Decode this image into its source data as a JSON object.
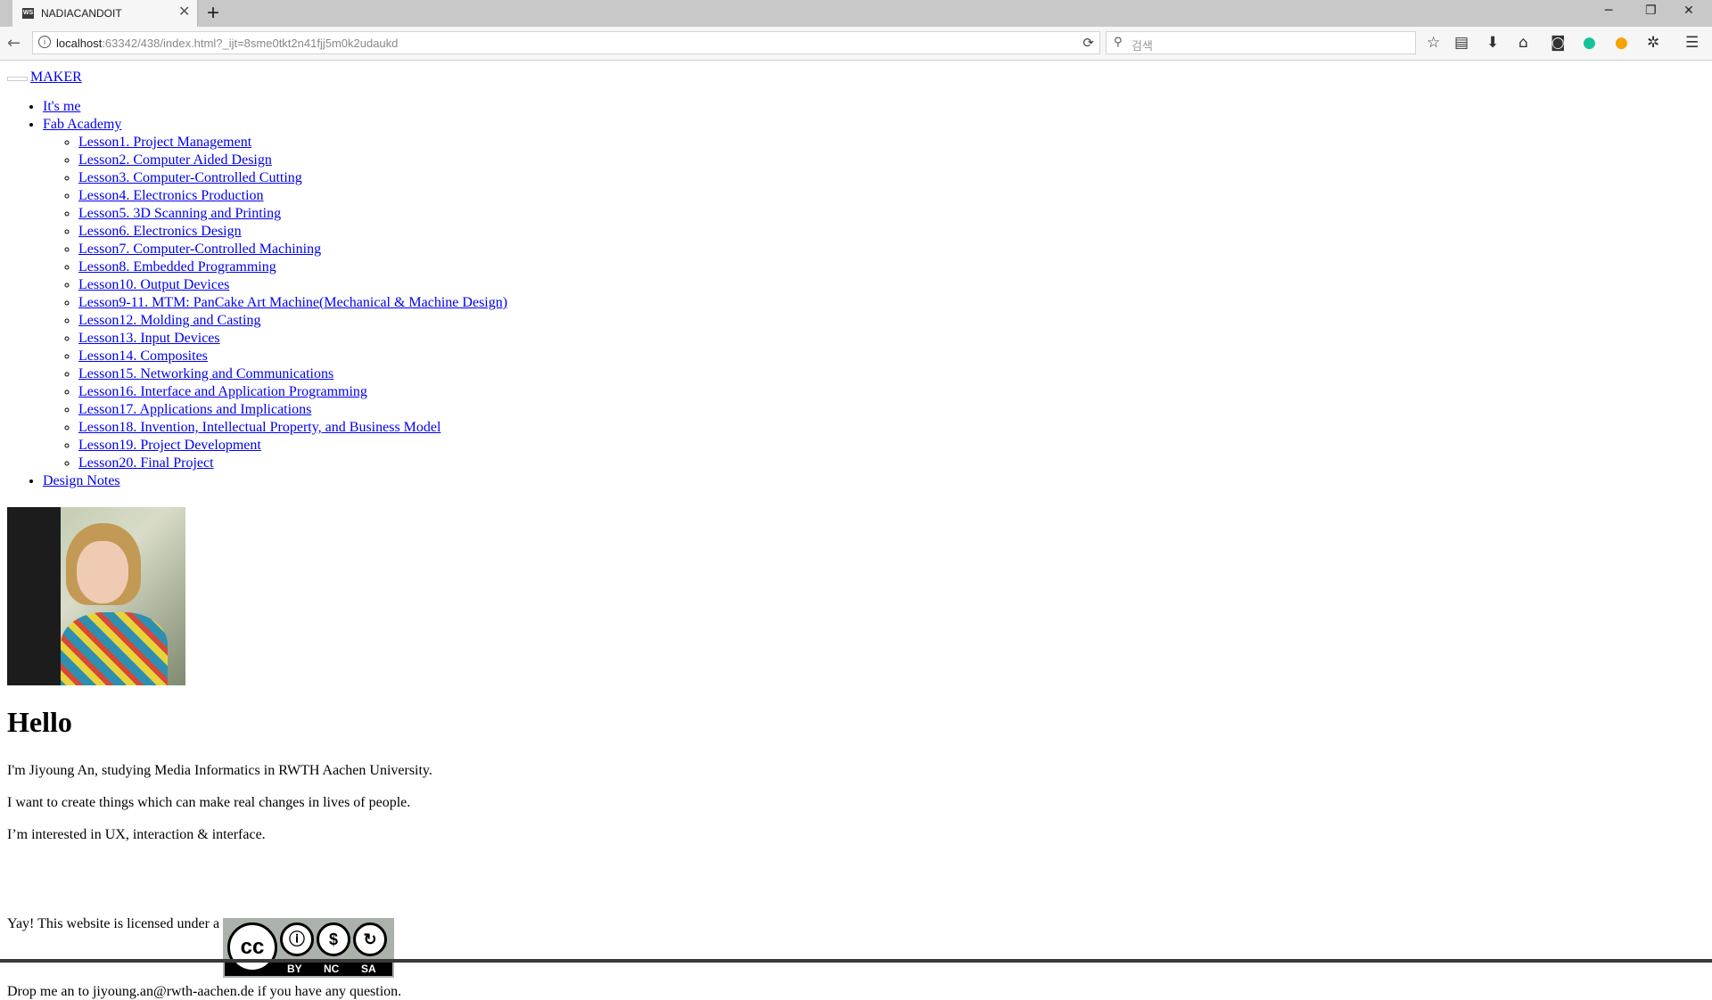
{
  "browser": {
    "tab_title": "NADIACANDOIT",
    "tab_favicon": "WS",
    "url_host": "localhost",
    "url_rest": ":63342/438/index.html?_ijt=8sme0tkt2n41fjj5m0k2udaukd",
    "search_placeholder": "검색",
    "icons": {
      "back": "back-arrow-icon",
      "info": "info-icon",
      "reload": "reload-icon",
      "search": "search-icon",
      "bookmark": "bookmark-star-icon",
      "reader": "reading-list-icon",
      "download": "download-icon",
      "home": "home-icon",
      "pocket": "pocket-icon",
      "grammarly": "grammarly-icon",
      "extension": "extension-icon",
      "puzzle": "addon-icon",
      "menu": "hamburger-menu-icon"
    }
  },
  "page": {
    "brand": "MAKER",
    "nav": {
      "its_me": "It's me",
      "fab_academy": "Fab Academy",
      "lessons": [
        "Lesson1. Project Management",
        "Lesson2. Computer Aided Design",
        "Lesson3. Computer-Controlled Cutting",
        "Lesson4. Electronics Production",
        "Lesson5. 3D Scanning and Printing",
        "Lesson6. Electronics Design",
        "Lesson7. Computer-Controlled Machining",
        "Lesson8. Embedded Programming",
        "Lesson10. Output Devices",
        "Lesson9-11. MTM: PanCake Art Machine(Mechanical & Machine Design)",
        "Lesson12. Molding and Casting",
        "Lesson13. Input Devices",
        "Lesson14. Composites",
        "Lesson15. Networking and Communications",
        "Lesson16. Interface and Application Programming",
        "Lesson17. Applications and Implications",
        "Lesson18. Invention, Intellectual Property, and Business Model",
        "Lesson19. Project Development",
        "Lesson20. Final Project"
      ],
      "design_notes": "Design Notes"
    },
    "heading": "Hello",
    "paragraphs": [
      "I'm Jiyoung An, studying Media Informatics in RWTH Aachen University.",
      "I want to create things which can make real changes in lives of people.",
      "I’m interested in UX, interaction & interface."
    ],
    "license_text": "Yay! This website is licensed under a",
    "cc_badge": {
      "cc": "cc",
      "by": "BY",
      "nc": "NC",
      "sa": "SA"
    },
    "contact": "Drop me an to jiyoung.an@rwth-aachen.de if you have any question."
  },
  "colors": {
    "link": "#0000ee",
    "tabbar": "#c8c8c8",
    "toolbar": "#f6f6f6",
    "cc_badge_bg": "#aab2ab"
  }
}
